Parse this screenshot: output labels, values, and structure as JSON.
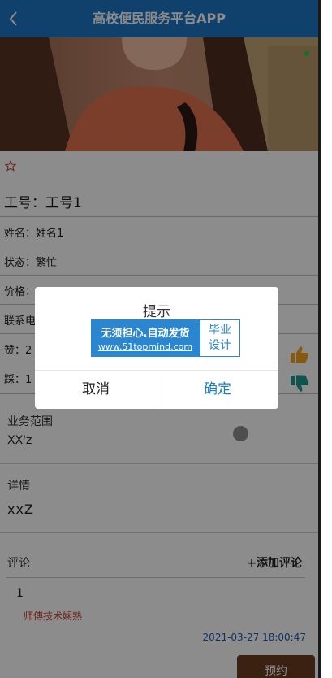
{
  "header": {
    "title": "高校便民服务平台APP",
    "back_icon": "chevron-left-icon"
  },
  "photo": {
    "description_icon": "worker-photo"
  },
  "favorite_icon": "star-outline-icon",
  "info": {
    "job_number": "工号：工号1",
    "name": "姓名：姓名1",
    "status": "状态：繁忙",
    "price": "价格：",
    "contact": "联系电",
    "likes": "赞：2",
    "dislikes": "踩：1"
  },
  "scope": {
    "label": "业务范围",
    "value": "XX'z"
  },
  "detail": {
    "label": "详情",
    "value": "xxZ"
  },
  "comments": {
    "label": "评论",
    "add_label": "+添加评论",
    "items": [
      {
        "index": "1",
        "text": "师傅技术娴熟",
        "time": "2021-03-27 18:00:47"
      }
    ]
  },
  "reserve_label": "预约",
  "dialog": {
    "title": "提示",
    "banner_line1": "无须担心.自动发货",
    "banner_line2": "www.51topmind.com",
    "banner_right": "毕业设计",
    "cancel_label": "取消",
    "confirm_label": "确定"
  },
  "colors": {
    "header": "#1e75c5",
    "thumb_up": "#f2a516",
    "thumb_down": "#1e9a8c",
    "confirm": "#1e7fc2",
    "reserve": "#6b3d1f"
  }
}
